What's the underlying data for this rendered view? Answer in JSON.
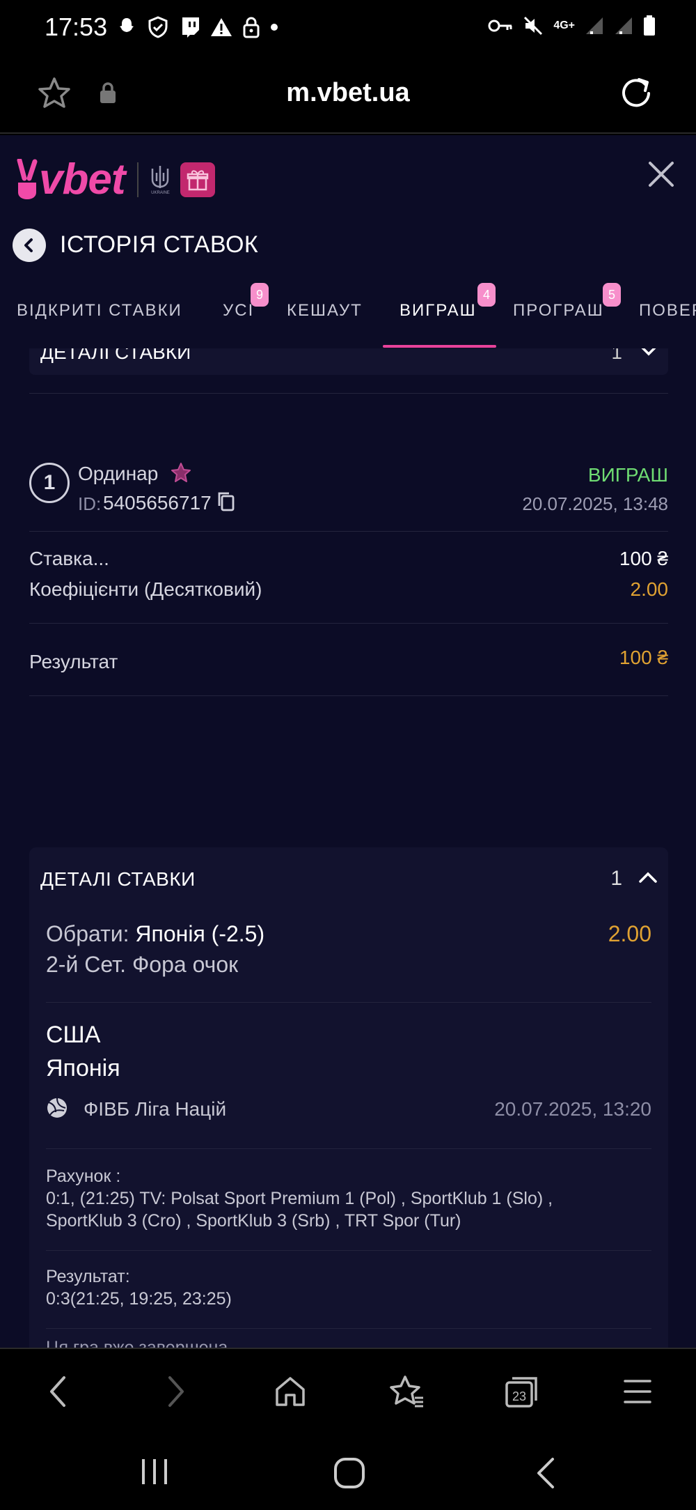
{
  "status_bar": {
    "time": "17:53",
    "network": "4G+"
  },
  "browser": {
    "url": "m.vbet.ua"
  },
  "app": {
    "logo_text": "vbet",
    "logo_sub": "UKRAINE",
    "page_title": "ІСТОРІЯ СТАВОК",
    "tabs": [
      {
        "label": "ВІДКРИТІ СТАВКИ",
        "badge": ""
      },
      {
        "label": "УСІ",
        "badge": "9"
      },
      {
        "label": "КЕШАУТ",
        "badge": ""
      },
      {
        "label": "ВИГРАШ",
        "badge": "4"
      },
      {
        "label": "ПРОГРАШ",
        "badge": "5"
      },
      {
        "label": "ПОВЕР",
        "badge": ""
      }
    ]
  },
  "prev_card": {
    "details_label": "ДЕТАЛІ СТАВКИ",
    "count": "1"
  },
  "bet": {
    "type": "Ординар",
    "icon_number": "1",
    "id_label": "ID:",
    "id": "5405656717",
    "status": "ВИГРАШ",
    "date": "20.07.2025, 13:48",
    "stake_label": "Ставка...",
    "stake_value": "100 ₴",
    "odds_label": "Коефіцієнти (Десятковий)",
    "odds_value": "2.00",
    "result_label": "Результат",
    "result_value": "100 ₴",
    "details": {
      "label": "ДЕТАЛІ СТАВКИ",
      "count": "1",
      "selection_label": "Обрати: ",
      "selection_value": "Японія (-2.5)",
      "selection_odds": "2.00",
      "market": "2-й Сет. Фора очок",
      "team1": "США",
      "team2": "Японія",
      "league": "ФІВБ Ліга Націй",
      "match_date": "20.07.2025, 13:20",
      "score_label": "Рахунок :",
      "score_line1": "0:1, (21:25) TV: Polsat Sport Premium 1 (Pol) , SportKlub 1 (Slo) ,",
      "score_line2": "SportKlub 3 (Cro) , SportKlub 3 (Srb) , TRT Spor (Tur)",
      "result_label": "Результат:",
      "result_value": "0:3(21:25, 19:25, 23:25)",
      "finished": "Ця гра вже завершена"
    }
  },
  "colors": {
    "accent": "#e8429a",
    "win": "#6fdc72",
    "odds": "#e0a232",
    "bg": "#0c0c26"
  }
}
